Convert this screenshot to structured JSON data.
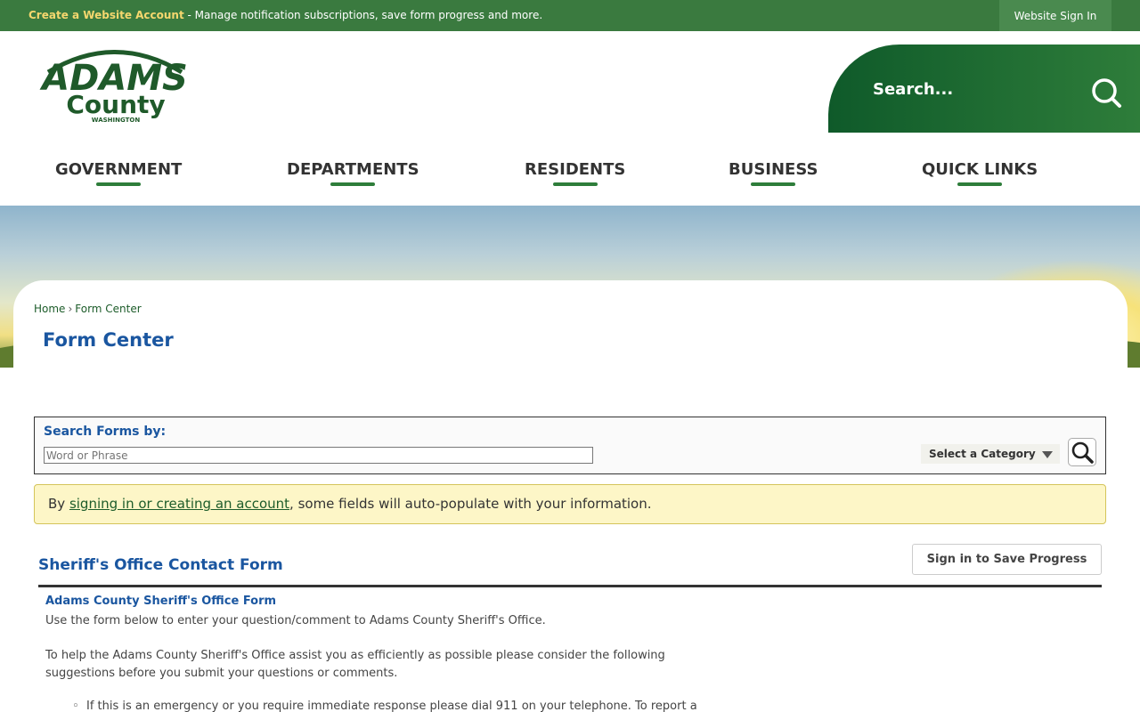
{
  "topbar": {
    "create_account_link": "Create a Website Account",
    "create_account_desc": " - Manage notification subscriptions, save form progress and more.",
    "sign_in": "Website Sign In"
  },
  "logo": {
    "line1": "ADAMS",
    "line2": "County",
    "line3": "WASHINGTON"
  },
  "search": {
    "placeholder": "Search..."
  },
  "nav": {
    "items": [
      {
        "label": "GOVERNMENT"
      },
      {
        "label": "DEPARTMENTS"
      },
      {
        "label": "RESIDENTS"
      },
      {
        "label": "BUSINESS"
      },
      {
        "label": "QUICK LINKS"
      }
    ]
  },
  "breadcrumb": {
    "home": "Home",
    "separator": "›",
    "current": "Form Center"
  },
  "page_title": "Form Center",
  "search_forms": {
    "label": "Search Forms by:",
    "placeholder": "Word or Phrase",
    "category": "Select a Category"
  },
  "notice": {
    "prefix": "By ",
    "link": "signing in or creating an account",
    "suffix": ", some fields will auto-populate with your information."
  },
  "form": {
    "title": "Sheriff's Office Contact Form",
    "save_button": "Sign in to Save Progress",
    "subtitle": "Adams County Sheriff's Office Form",
    "intro": "Use the form below to enter your question/comment to Adams County Sheriff's Office.",
    "help_line1": "To help the Adams County Sheriff's Office assist you as efficiently as possible please consider the following",
    "help_line2": "suggestions before you submit your questions or comments.",
    "bullet1": "If this is an emergency or you require immediate response please dial 911 on your telephone. To report a"
  },
  "colors": {
    "brand_green": "#3a7a3f",
    "accent_green": "#2e7d3a",
    "title_blue": "#1a56a0",
    "notice_bg": "#fdf6c7"
  }
}
